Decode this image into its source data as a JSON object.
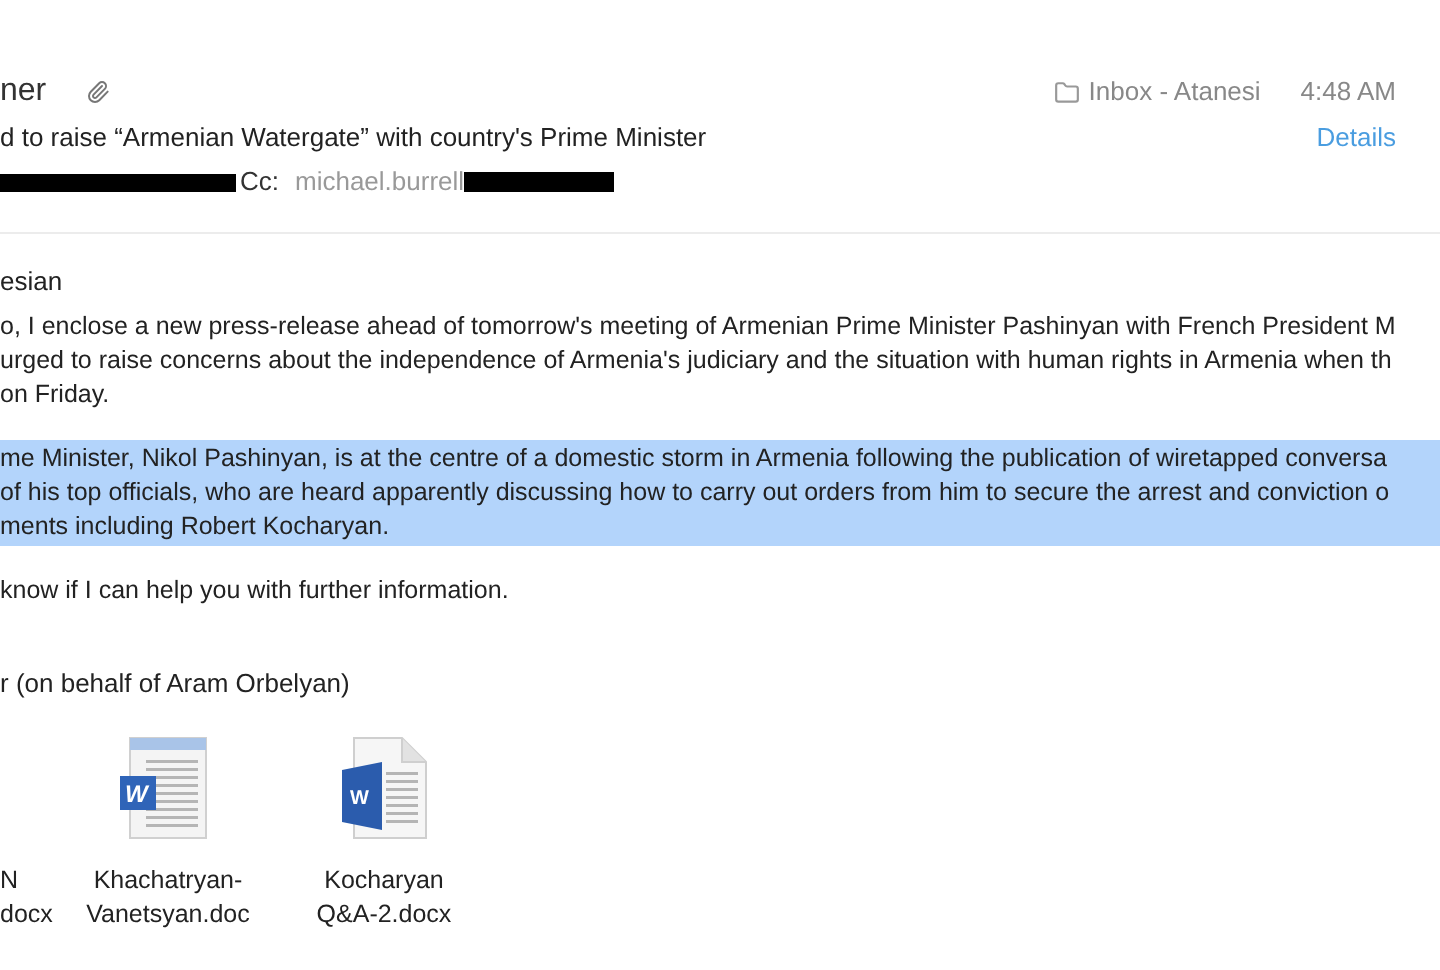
{
  "header": {
    "sender": "ner",
    "subject": "d to raise “Armenian Watergate” with country's Prime Minister",
    "cc_label": "Cc:",
    "cc_value": "michael.burrell",
    "mailbox": "Inbox - Atanesi",
    "time": "4:48 AM",
    "details_link": "Details",
    "has_attachment": true
  },
  "body": {
    "greeting": "esian",
    "paragraphs": [
      {
        "selected": false,
        "lines": [
          "o, I enclose a new press-release ahead of tomorrow's meeting of Armenian Prime Minister Pashinyan with French President M",
          "urged to raise concerns about the independence of Armenia's judiciary and the situation with human rights in Armenia when th",
          "on Friday."
        ]
      },
      {
        "selected": true,
        "lines": [
          "me Minister, Nikol Pashinyan, is at the centre of a domestic storm in Armenia following the publication of wiretapped conversa",
          "of his top officials, who are heard apparently discussing how to carry out orders from him to secure the arrest and conviction o",
          "ments including Robert Kocharyan."
        ]
      },
      {
        "selected": false,
        "lines": [
          "know if I can help you with further information."
        ]
      }
    ],
    "signature": "r (on behalf of Aram Orbelyan)"
  },
  "attachments": [
    {
      "kind": "offscreen",
      "lines": [
        "N",
        "docx"
      ]
    },
    {
      "kind": "doc",
      "icon_letter": "W",
      "lines": [
        "Khachatryan-",
        "Vanetsyan.doc"
      ]
    },
    {
      "kind": "docx",
      "icon_letter": "W",
      "lines": [
        "Kocharyan",
        "Q&A-2.docx"
      ]
    }
  ]
}
